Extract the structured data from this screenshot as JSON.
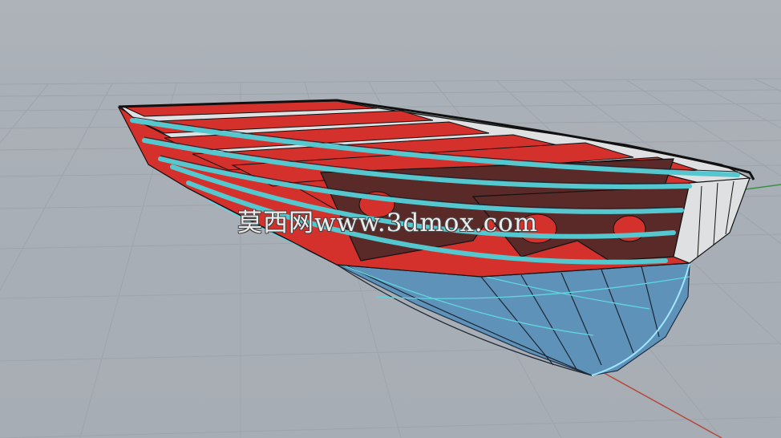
{
  "viewport": {
    "name": "3D modeling viewport (perspective)",
    "background_color": "#aab0b7",
    "grid_color": "#9aa0a7",
    "x_axis_color": "#b54a3c",
    "y_axis_color": "#3b8f45"
  },
  "model": {
    "description": "boat hull with frames and stringers",
    "colors": {
      "deck_red": "#d5312c",
      "frame_dark": "#5a2a28",
      "stringer_cyan": "#54c7cf",
      "hull_blue": "#5f92b8",
      "interior_white": "#dfe0e1"
    }
  },
  "watermark": {
    "text": "莫西网www.3dmox.com"
  }
}
